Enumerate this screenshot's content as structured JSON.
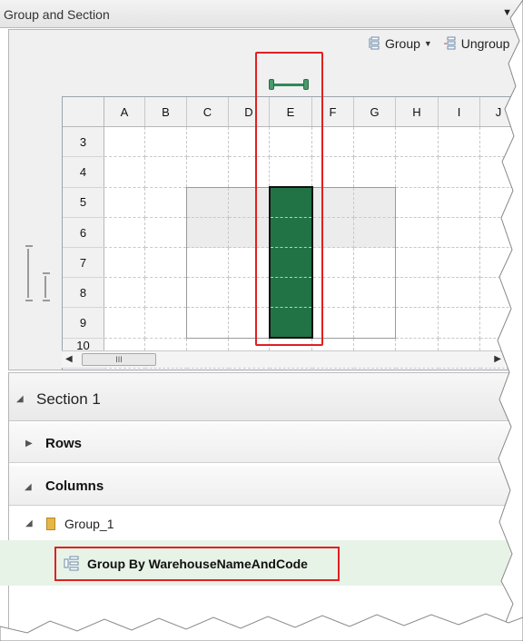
{
  "panel": {
    "title": "Group and Section",
    "menu_icon": "dropdown-arrow-icon"
  },
  "toolbar": {
    "group_label": "Group",
    "ungroup_label": "Ungroup",
    "group_icon": "group-icon",
    "ungroup_icon": "ungroup-icon"
  },
  "grid": {
    "columns": [
      "A",
      "B",
      "C",
      "D",
      "E",
      "F",
      "G",
      "H",
      "I",
      "J"
    ],
    "rows": [
      "3",
      "4",
      "5",
      "6",
      "7",
      "8",
      "9",
      "10"
    ]
  },
  "scrollbar": {
    "thumb": "III"
  },
  "section": {
    "title": "Section 1",
    "rows_label": "Rows",
    "columns_label": "Columns",
    "group_name": "Group_1",
    "group_by_label": "Group By WarehouseNameAndCode"
  },
  "colors": {
    "accent": "#217346",
    "highlight": "#e02020"
  }
}
